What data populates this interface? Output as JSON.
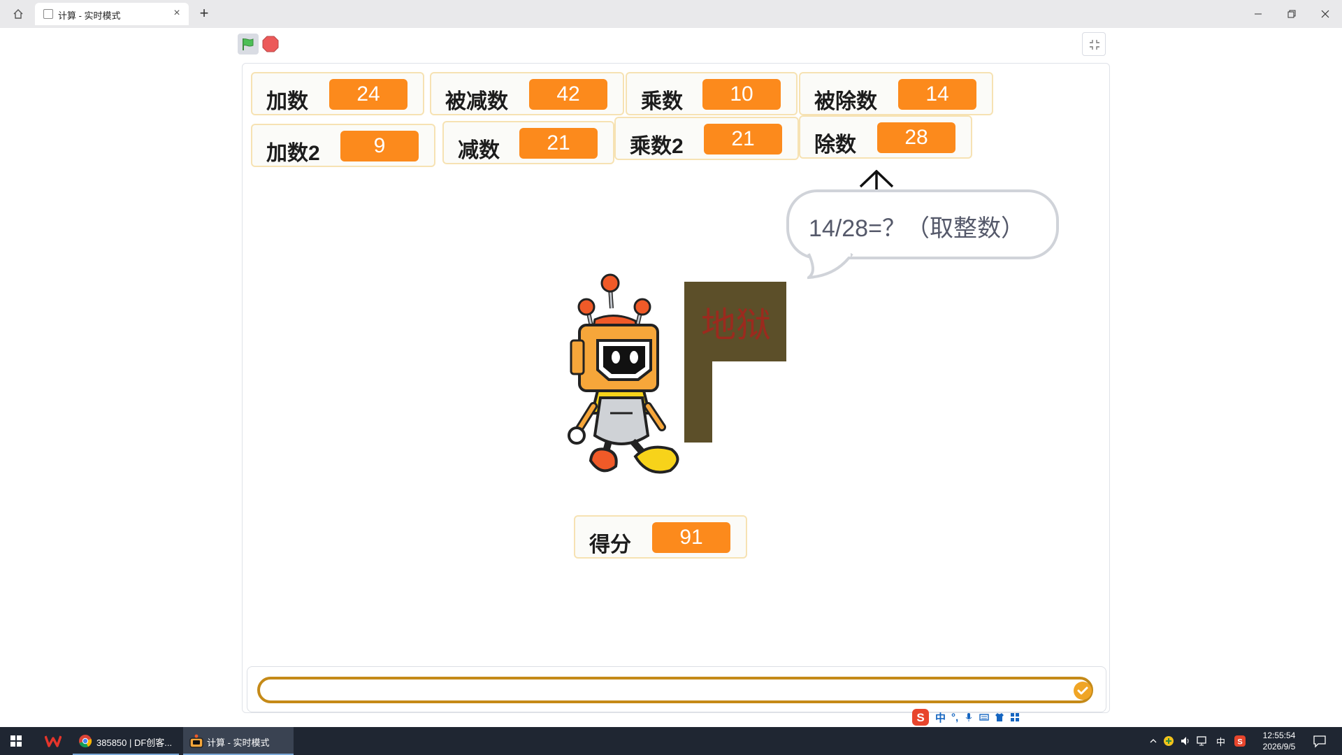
{
  "browser": {
    "tab_title": "计算 - 实时模式",
    "close_symbol": "×",
    "new_tab_symbol": "+"
  },
  "stage": {
    "monitors": {
      "addend": {
        "label": "加数",
        "value": "24"
      },
      "minuend": {
        "label": "被减数",
        "value": "42"
      },
      "multiplier": {
        "label": "乘数",
        "value": "10"
      },
      "dividend": {
        "label": "被除数",
        "value": "14"
      },
      "addend2": {
        "label": "加数2",
        "value": "9"
      },
      "subtrahend": {
        "label": "减数",
        "value": "21"
      },
      "multiplier2": {
        "label": "乘数2",
        "value": "21"
      },
      "divisor": {
        "label": "除数",
        "value": "28"
      },
      "score": {
        "label": "得分",
        "value": "91"
      }
    },
    "speech_text": "14/28=？（取整数）",
    "sign_text": "地狱",
    "answer_value": ""
  },
  "ime": {
    "mode_label": "中",
    "punct_label": "°,"
  },
  "taskbar": {
    "apps": [
      {
        "label": ""
      },
      {
        "label": "385850 | DF创客..."
      },
      {
        "label": "计算 - 实时模式"
      }
    ],
    "ime_indicator": "中",
    "time": "12:55:54",
    "date": "2026/9/5"
  },
  "colors": {
    "monitor_value_bg": "#fc8a1c",
    "monitor_border": "#f6e2b3",
    "sign_board": "#5c4f29",
    "sign_text": "#9b2a1e",
    "answer_border": "#c58a18",
    "taskbar_bg": "#1f2632",
    "flag_green": "#4cbf56",
    "stop_red": "#ec5959"
  },
  "icons": [
    "home-icon",
    "page-favicon-icon",
    "close-icon",
    "plus-icon",
    "minimize-icon",
    "restore-icon",
    "window-close-icon",
    "green-flag-icon",
    "stop-icon",
    "fullscreen-exit-icon",
    "check-icon",
    "sogou-icon",
    "windows-start-icon",
    "wps-icon",
    "chrome-icon",
    "scratch-icon",
    "notification-icon"
  ]
}
